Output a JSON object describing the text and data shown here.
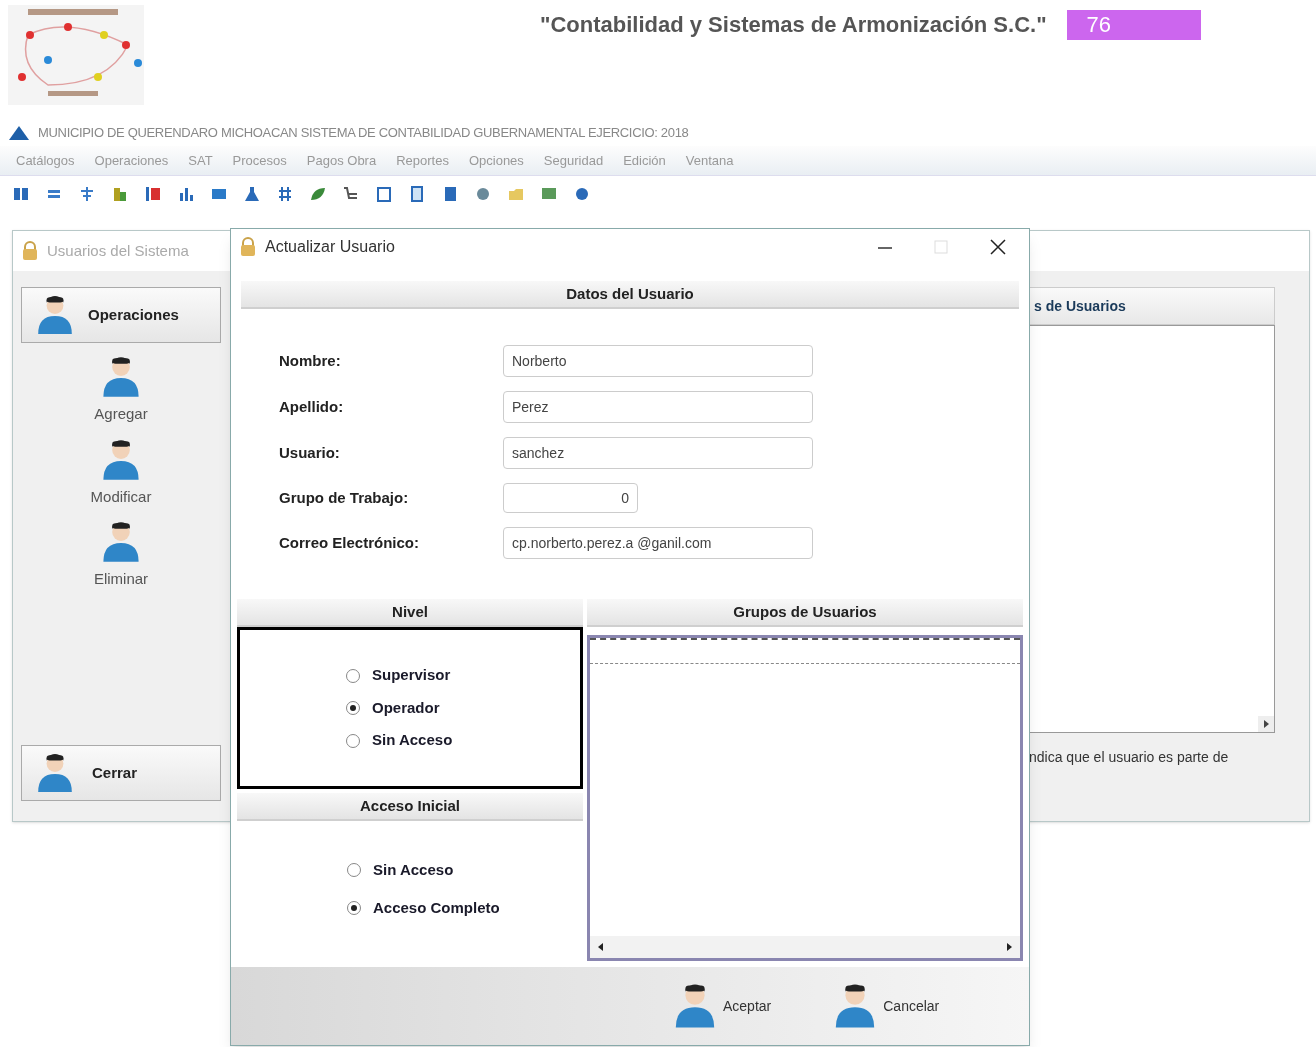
{
  "header": {
    "company": "\"Contabilidad y Sistemas de Armonización S.C.\"",
    "page_number": "76"
  },
  "app": {
    "title": "MUNICIPIO DE QUERENDARO MICHOACAN SISTEMA DE CONTABILIDAD GUBERNAMENTAL EJERCICIO: 2018",
    "menu": [
      "Catálogos",
      "Operaciones",
      "SAT",
      "Procesos",
      "Pagos Obra",
      "Reportes",
      "Opciones",
      "Seguridad",
      "Edición",
      "Ventana"
    ]
  },
  "back_window": {
    "title": "Usuarios del Sistema",
    "sidebar_header": "Operaciones",
    "actions": [
      "Agregar",
      "Modificar",
      "Eliminar"
    ],
    "close_action": "Cerrar",
    "panel_title": "s de Usuarios",
    "note": "ndica que el usuario es parte de"
  },
  "dialog": {
    "title": "Actualizar Usuario",
    "section_title": "Datos del Usuario",
    "fields": [
      {
        "label": "Nombre:",
        "value": "Norberto",
        "kind": "text"
      },
      {
        "label": "Apellido:",
        "value": "Perez",
        "kind": "text"
      },
      {
        "label": "Usuario:",
        "value": "sanchez",
        "kind": "text"
      },
      {
        "label": "Grupo de Trabajo:",
        "value": "0",
        "kind": "number"
      },
      {
        "label": "Correo Electrónico:",
        "value": "cp.norberto.perez.a @ganil.com",
        "kind": "text"
      }
    ],
    "nivel": {
      "title": "Nivel",
      "options": [
        {
          "label": "Supervisor",
          "selected": false
        },
        {
          "label": "Operador",
          "selected": true
        },
        {
          "label": "Sin Acceso",
          "selected": false
        }
      ]
    },
    "acceso": {
      "title": "Acceso Inicial",
      "options": [
        {
          "label": "Sin Acceso",
          "selected": false
        },
        {
          "label": "Acceso Completo",
          "selected": true
        }
      ]
    },
    "grupos": {
      "title": "Grupos de Usuarios"
    },
    "buttons": [
      "Aceptar",
      "Cancelar"
    ]
  }
}
